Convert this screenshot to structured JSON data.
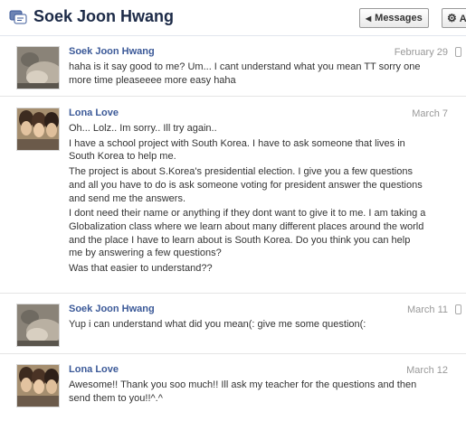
{
  "header": {
    "title": "Soek Joon Hwang",
    "messages_button": "Messages",
    "actions_button": "A"
  },
  "messages": [
    {
      "sender": "Soek Joon Hwang",
      "date": "February 29",
      "has_phone_icon": true,
      "paragraphs": [
        "haha is it say good to me? Um... I cant understand what you mean TT sorry one more time pleaseeee more easy haha"
      ]
    },
    {
      "sender": "Lona Love",
      "date": "March 7",
      "has_phone_icon": false,
      "paragraphs": [
        "Oh... Lolz.. Im sorry.. Ill try again..",
        "I have a school project with South Korea. I have to ask someone that lives in South Korea to help me.",
        "The project is about S.Korea's presidential election. I give you a few questions and all you have to do is ask someone voting for president answer the questions and send me the answers.",
        "I dont need their name or anything if they dont want to give it to me. I am taking a Globalization class where we learn about many different places around the world and the place I have to learn about is South Korea. Do you think you can help me by answering a few questions?",
        "Was that easier to understand??"
      ]
    },
    {
      "sender": "Soek Joon Hwang",
      "date": "March 11",
      "has_phone_icon": true,
      "paragraphs": [
        "Yup i can understand what did you mean(: give me some question(:"
      ]
    },
    {
      "sender": "Lona Love",
      "date": "March 12",
      "has_phone_icon": false,
      "paragraphs": [
        "Awesome!! Thank you soo much!! Ill ask my teacher for the questions and then send them to you!!^.^"
      ]
    }
  ],
  "icons": {
    "header": "messages-icon",
    "back": "chevron-left-icon",
    "actions": "gear-icon",
    "mobile": "phone-icon"
  }
}
